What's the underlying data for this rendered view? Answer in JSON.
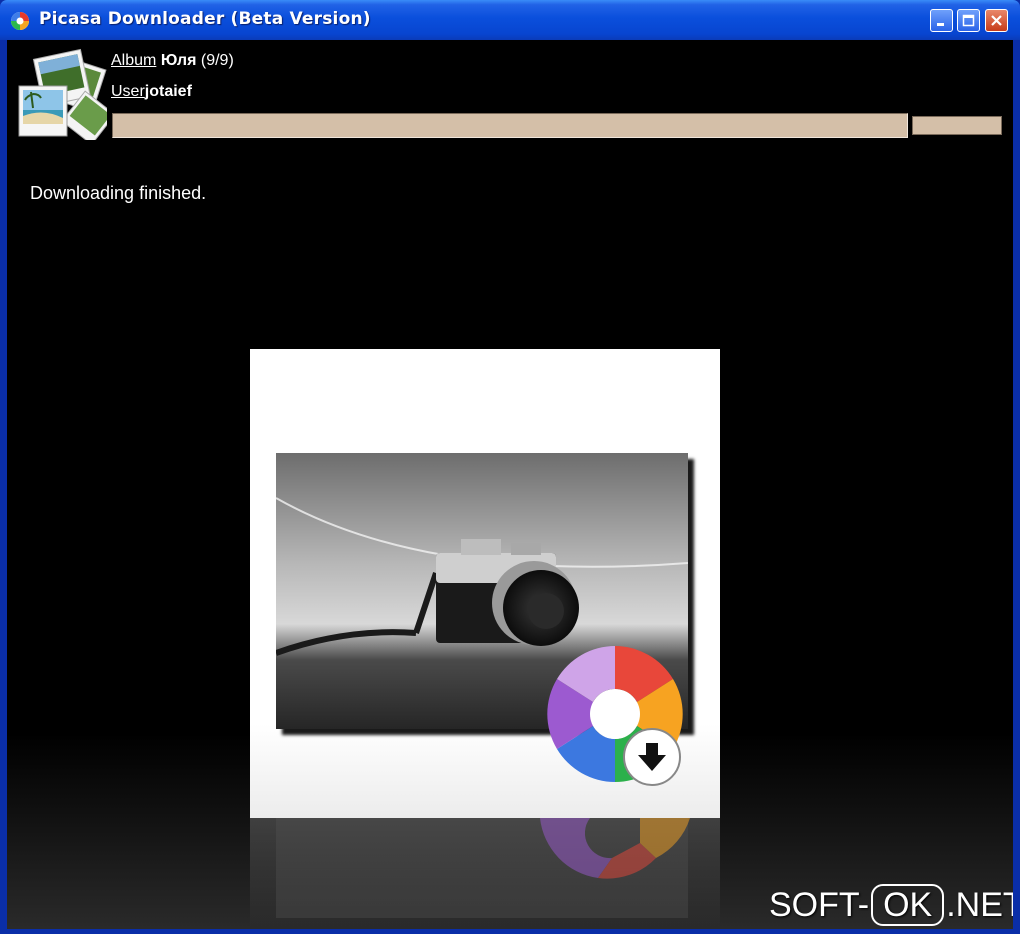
{
  "window": {
    "title": "Picasa Downloader (Beta Version)",
    "controls": [
      "minimize-icon",
      "maximize-icon",
      "close-icon"
    ]
  },
  "header": {
    "album_label": "Album",
    "album_name": "Юля",
    "album_count": "(9/9)",
    "user_label": "User",
    "user_name": "jotaief"
  },
  "progress": {
    "overall_fraction": 1.0,
    "current_fraction": 1.0
  },
  "status": {
    "text": "Downloading finished."
  },
  "watermark": {
    "prefix": "SOFT-",
    "boxed": "OK",
    "suffix": ".NET"
  },
  "colors": {
    "titlebar": "#0a4fdc",
    "background": "#000000",
    "progress": "#d4bfa8"
  },
  "icons": {
    "app": "picasa-icon",
    "album": "photo-stack-icon",
    "logo": "picasa-download-logo"
  }
}
